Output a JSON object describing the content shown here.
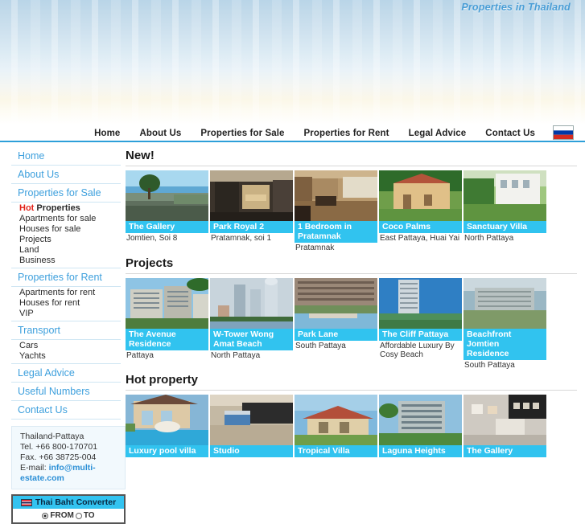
{
  "header": {
    "tagline": "Properties in Thailand",
    "flag_icon": "russian-flag-icon",
    "flag_title": "Russian"
  },
  "topnav": {
    "items": [
      {
        "label": "Home"
      },
      {
        "label": "About Us"
      },
      {
        "label": "Properties for Sale"
      },
      {
        "label": "Properties for Rent"
      },
      {
        "label": "Legal Advice"
      },
      {
        "label": "Contact Us"
      }
    ]
  },
  "sidebar": {
    "main_items": [
      {
        "label": "Home"
      },
      {
        "label": "About Us"
      },
      {
        "label": "Properties for Sale"
      },
      {
        "label": "Properties for Rent"
      },
      {
        "label": "Transport"
      },
      {
        "label": "Legal Advice"
      },
      {
        "label": "Useful Numbers"
      },
      {
        "label": "Contact Us"
      }
    ],
    "sale_subitems": [
      {
        "hot": "Hot",
        "label": "Properties"
      },
      {
        "label": "Apartments for sale"
      },
      {
        "label": "Houses for sale"
      },
      {
        "label": "Projects"
      },
      {
        "label": "Land"
      },
      {
        "label": "Business"
      }
    ],
    "rent_subitems": [
      {
        "label": "Apartments for rent"
      },
      {
        "label": "Houses for rent"
      },
      {
        "label": "VIP"
      }
    ],
    "transport_subitems": [
      {
        "label": "Cars"
      },
      {
        "label": "Yachts"
      }
    ],
    "contact": {
      "location": "Thailand-Pattaya",
      "tel": "Tel.  +66 800-170701",
      "fax": "Fax. +66 38725-004",
      "email_label": "E-mail:",
      "email_line1": "info@multi-",
      "email_line2": "estate.com"
    },
    "converter": {
      "title": "Thai Baht Converter",
      "flag_icon": "thai-flag-icon",
      "from_label": "FROM",
      "to_label": "TO",
      "selected": "FROM"
    }
  },
  "sections": [
    {
      "title": "New!",
      "cards": [
        {
          "name": "The Gallery",
          "location": "Jomtien, Soi 8",
          "img": "pool-terrace-sea-view"
        },
        {
          "name": "Park Royal 2",
          "location": "Pratamnak, soi 1",
          "img": "modern-lobby-interior"
        },
        {
          "name": "1 Bedroom in Pratamnak",
          "location": "Pratamnak",
          "img": "apartment-living-room"
        },
        {
          "name": "Coco Palms",
          "location": "East Pattaya, Huai Yai",
          "img": "spanish-villa-exterior"
        },
        {
          "name": "Sanctuary Villa",
          "location": "North Pattaya",
          "img": "white-modern-house"
        }
      ]
    },
    {
      "title": "Projects",
      "cards": [
        {
          "name": "The Avenue Residence",
          "location": "Pattaya",
          "img": "condo-complex-render"
        },
        {
          "name": "W-Tower Wong Amat Beach",
          "location": "North Pattaya",
          "img": "highrise-skyline-beach"
        },
        {
          "name": "Park Lane",
          "location": "South Pattaya",
          "img": "low-rise-condo-pool"
        },
        {
          "name": "The Cliff Pattaya",
          "location": "Affordable Luxury By Cosy Beach",
          "img": "tower-on-hill"
        },
        {
          "name": "Beachfront Jomtien Residence",
          "location": "South Pattaya",
          "img": "beachfront-building"
        }
      ]
    },
    {
      "title": "Hot property",
      "cards": [
        {
          "name": "Luxury pool villa",
          "location": "",
          "img": "villa-with-pool"
        },
        {
          "name": "Studio",
          "location": "",
          "img": "studio-bedroom"
        },
        {
          "name": "Tropical Villa",
          "location": "",
          "img": "tropical-house"
        },
        {
          "name": "Laguna Heights",
          "location": "",
          "img": "laguna-condo"
        },
        {
          "name": "The Gallery",
          "location": "",
          "img": "modern-kitchen"
        }
      ]
    }
  ],
  "colors": {
    "accent_cyan": "#31c3ef",
    "link_blue": "#3ea0dd",
    "nav_underline": "#2d9fd9",
    "hot_red": "#e2231a"
  }
}
